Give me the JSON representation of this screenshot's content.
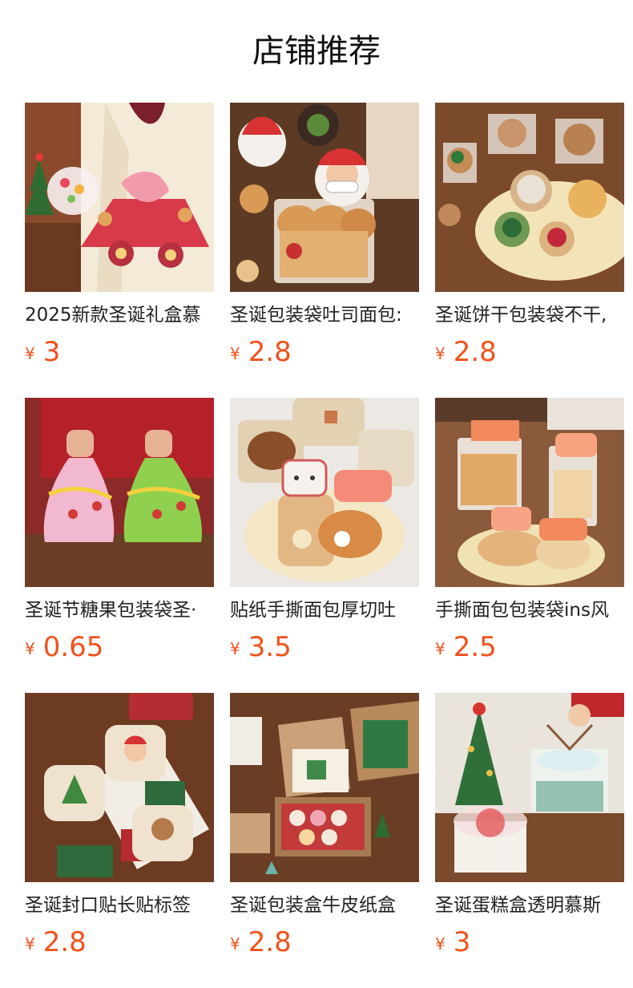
{
  "header": {
    "title": "店铺推荐"
  },
  "currency": "¥",
  "products": [
    {
      "name": "2025新款圣诞礼盒慕",
      "price": "3",
      "image": "christmas-gift-box-photo"
    },
    {
      "name": "圣诞包装袋吐司面包:",
      "price": "2.8",
      "image": "santa-toast-bag-photo"
    },
    {
      "name": "圣诞饼干包装袋不干,",
      "price": "2.8",
      "image": "cookie-bags-photo"
    },
    {
      "name": "圣诞节糖果包装袋圣·",
      "price": "0.65",
      "image": "christmas-tree-candy-bags-photo"
    },
    {
      "name": "贴纸手撕面包厚切吐",
      "price": "3.5",
      "image": "bread-stickers-photo"
    },
    {
      "name": "手撕面包包装袋ins风",
      "price": "2.5",
      "image": "toast-bags-photo"
    },
    {
      "name": "圣诞封口贴长贴标签",
      "price": "2.8",
      "image": "christmas-seal-stickers-photo"
    },
    {
      "name": "圣诞包装盒牛皮纸盒",
      "price": "2.8",
      "image": "kraft-gift-box-photo"
    },
    {
      "name": "圣诞蛋糕盒透明慕斯",
      "price": "3",
      "image": "clear-cake-box-photo"
    }
  ]
}
